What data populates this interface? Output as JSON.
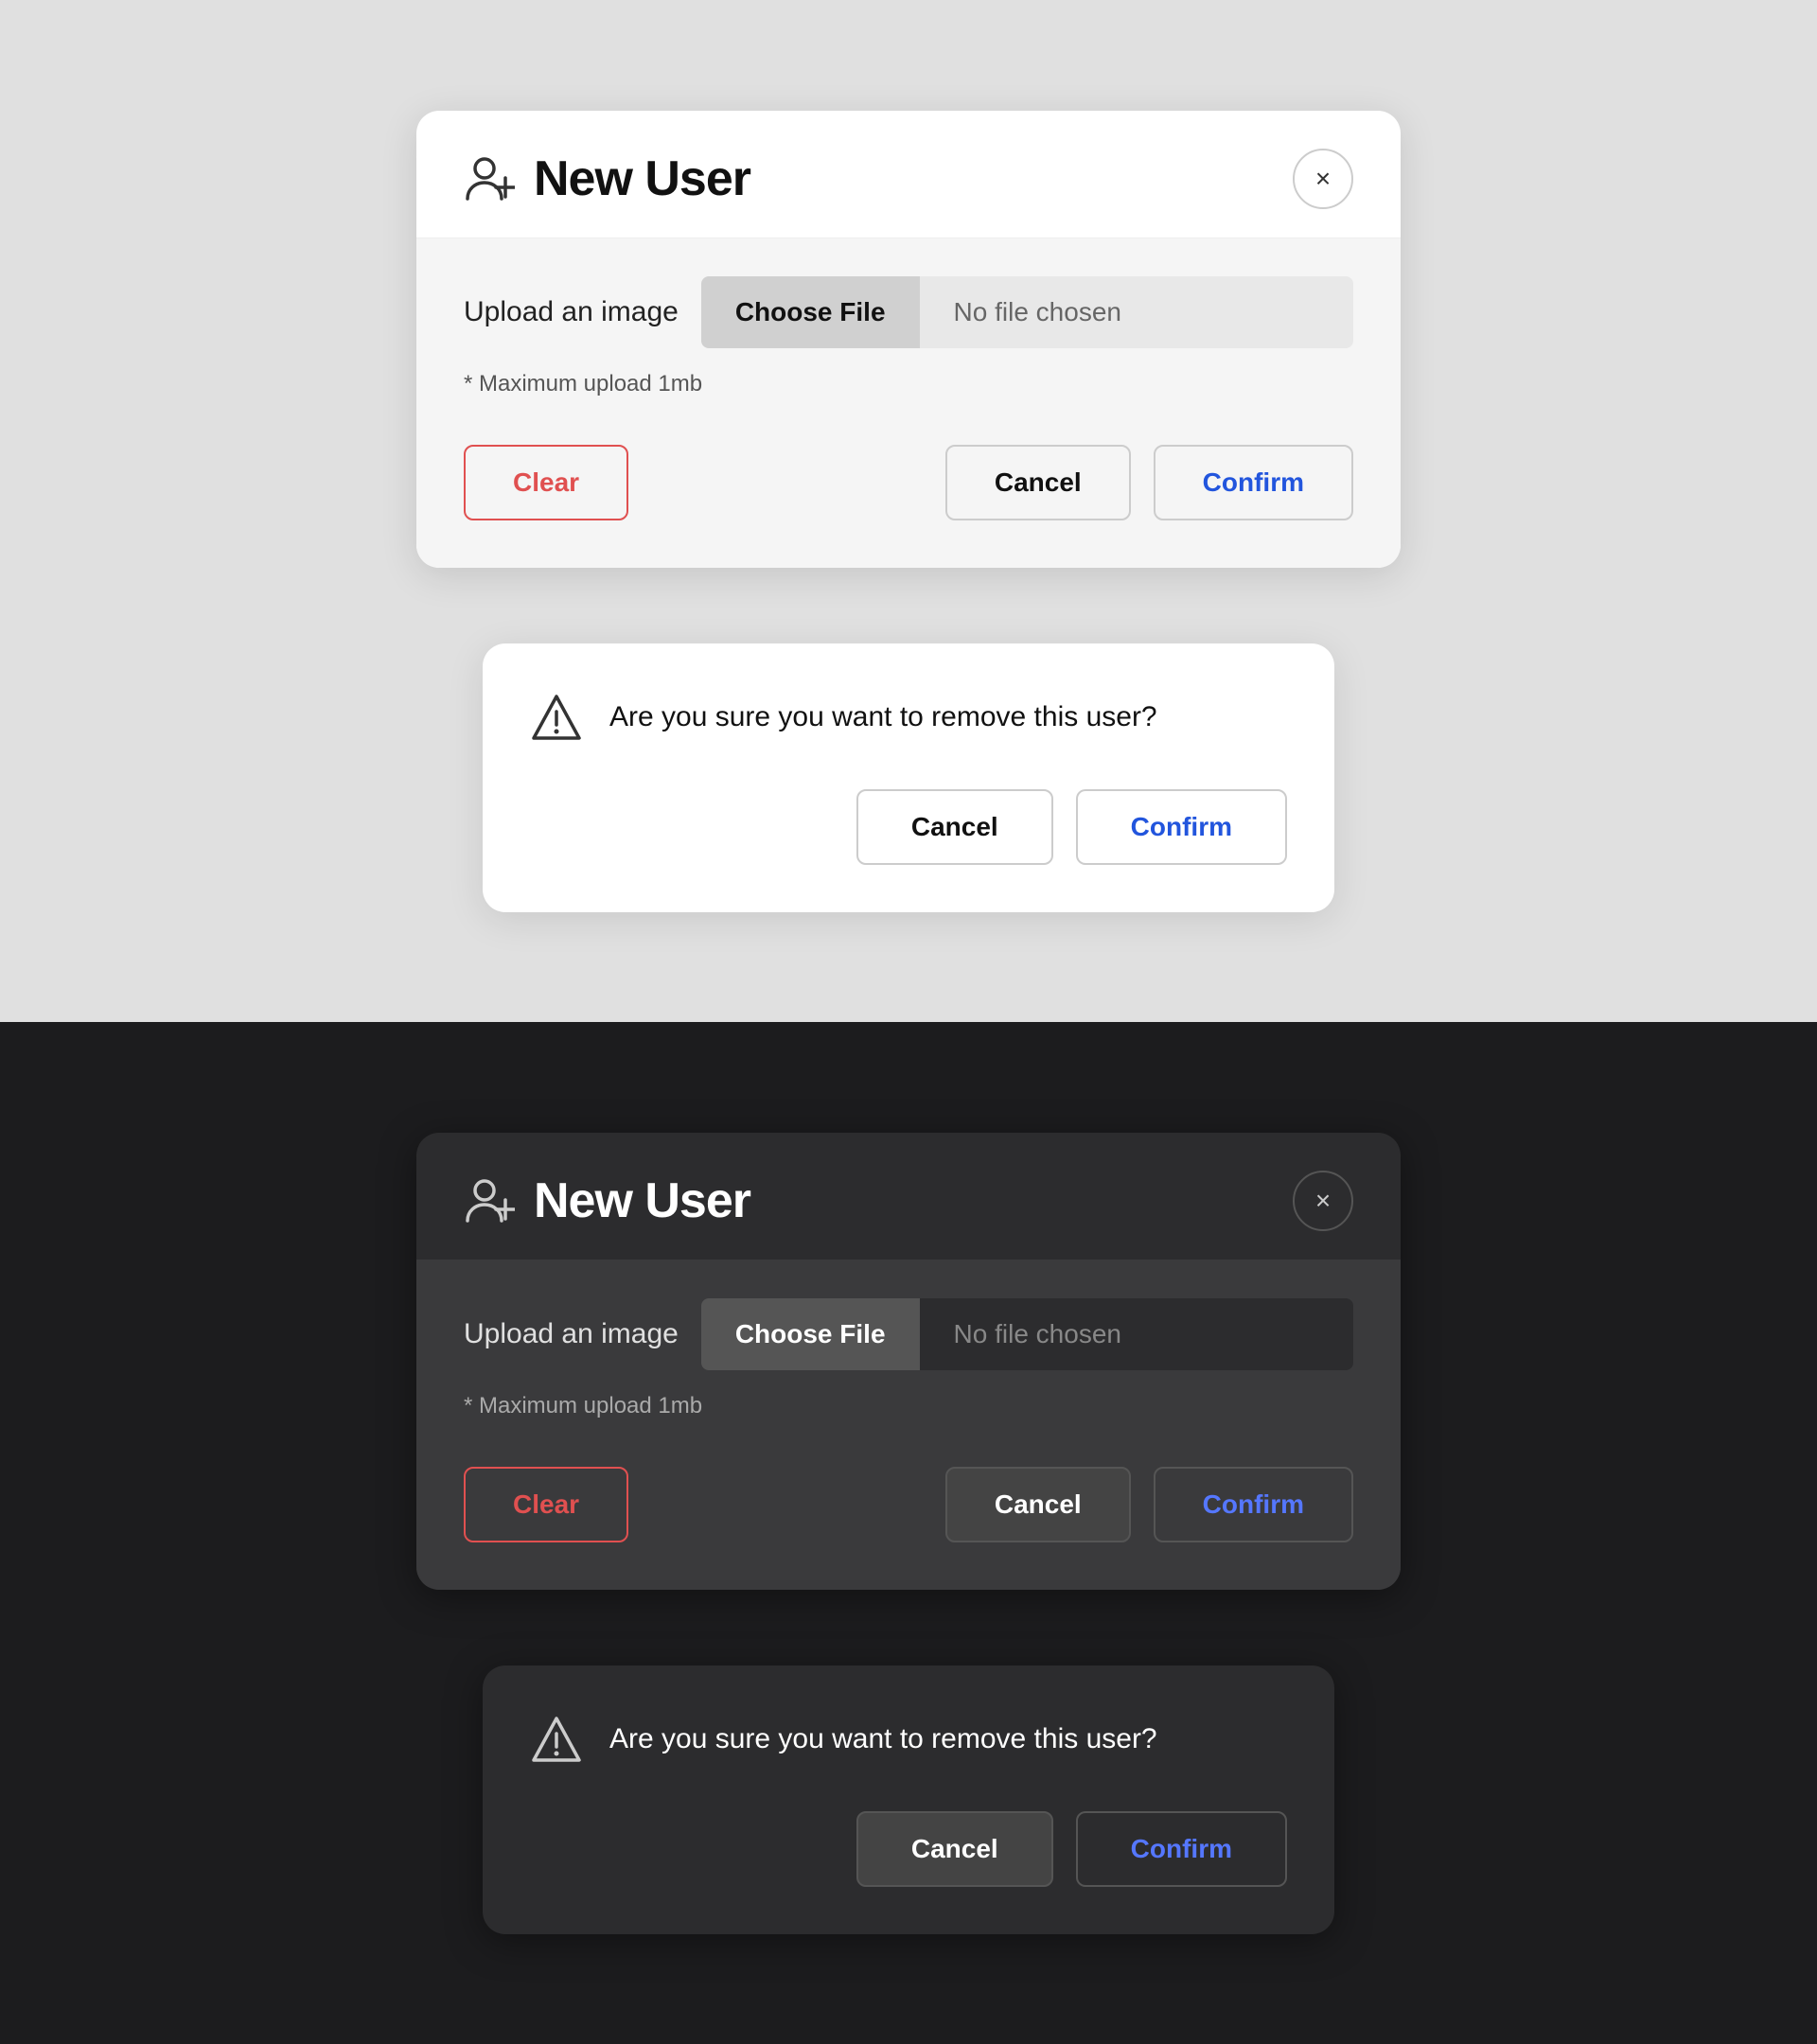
{
  "light": {
    "theme": "light",
    "modal": {
      "title": "New User",
      "close_label": "×",
      "upload_label": "Upload an image",
      "choose_file_label": "Choose File",
      "no_file_label": "No file chosen",
      "max_upload_note": "* Maximum upload 1mb",
      "clear_label": "Clear",
      "cancel_label": "Cancel",
      "confirm_label": "Confirm"
    },
    "confirm_dialog": {
      "message": "Are you sure you want to remove this user?",
      "cancel_label": "Cancel",
      "confirm_label": "Confirm"
    }
  },
  "dark": {
    "theme": "dark",
    "modal": {
      "title": "New User",
      "close_label": "×",
      "upload_label": "Upload an image",
      "choose_file_label": "Choose File",
      "no_file_label": "No file chosen",
      "max_upload_note": "* Maximum upload 1mb",
      "clear_label": "Clear",
      "cancel_label": "Cancel",
      "confirm_label": "Confirm"
    },
    "confirm_dialog": {
      "message": "Are you sure you want to remove this user?",
      "cancel_label": "Cancel",
      "confirm_label": "Confirm"
    }
  }
}
